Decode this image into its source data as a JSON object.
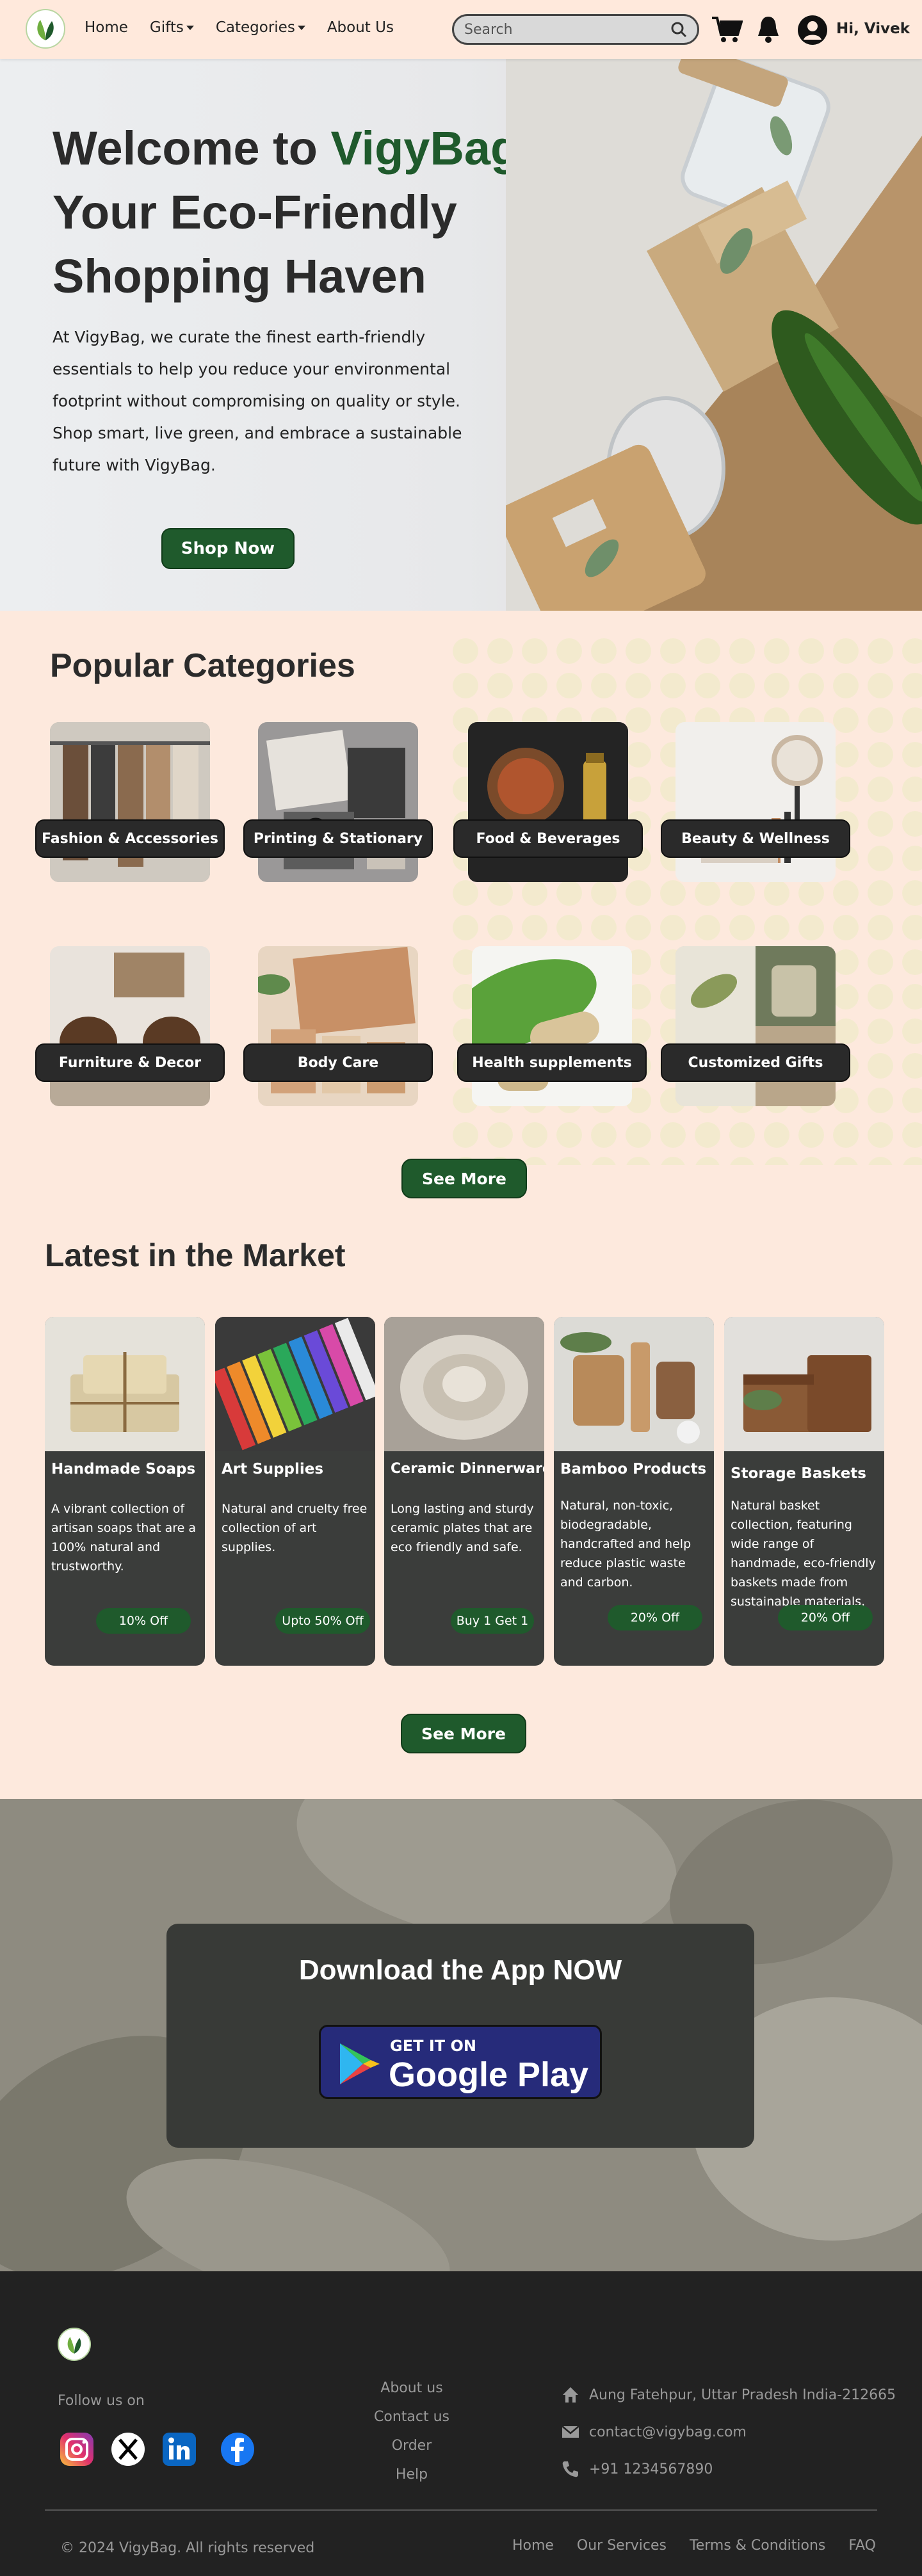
{
  "nav": {
    "links": [
      "Home",
      "Gifts",
      "Categories",
      "About Us"
    ],
    "search_placeholder": "Search",
    "user_greeting": "Hi, Vivek"
  },
  "hero": {
    "title_part1": "Welcome to ",
    "brand": "VigyBag",
    "title_part2": "!",
    "title_line2": "Your Eco-Friendly",
    "title_line3": "Shopping Haven",
    "description": "At VigyBag, we curate the finest earth-friendly essentials to help you reduce your environmental footprint without compromising on quality or style. Shop smart, live green, and embrace a sustainable future with VigyBag.",
    "cta": "Shop Now"
  },
  "categories": {
    "title": "Popular Categories",
    "items": [
      {
        "label": "Fashion & Accessories"
      },
      {
        "label": "Printing & Stationary"
      },
      {
        "label": "Food & Beverages"
      },
      {
        "label": "Beauty & Wellness"
      },
      {
        "label": "Furniture & Decor"
      },
      {
        "label": "Body Care"
      },
      {
        "label": "Health supplements"
      },
      {
        "label": "Customized Gifts"
      }
    ],
    "see_more": "See More"
  },
  "latest": {
    "title": "Latest in the Market",
    "items": [
      {
        "name": "Handmade Soaps",
        "desc": "A vibrant collection of artisan soaps that are a 100% natural and trustworthy.",
        "offer": "10% Off"
      },
      {
        "name": "Art Supplies",
        "desc": "Natural and cruelty free collection of art supplies.",
        "offer": "Upto 50% Off"
      },
      {
        "name": "Ceramic Dinnerware",
        "desc": "Long lasting and sturdy ceramic plates that are eco friendly and safe.",
        "offer": "Buy 1 Get 1"
      },
      {
        "name": "Bamboo Products",
        "desc": "Natural, non-toxic, biodegradable, handcrafted and help reduce plastic waste and carbon.",
        "offer": "20% Off"
      },
      {
        "name": "Storage Baskets",
        "desc": "Natural basket collection, featuring wide range of handmade, eco-friendly baskets made from sustainable materials.",
        "offer": "20% Off"
      }
    ],
    "see_more": "See More"
  },
  "app": {
    "title": "Download the App NOW",
    "badge_small": "GET IT ON",
    "badge_large": "Google Play"
  },
  "footer": {
    "follow": "Follow us on",
    "links": [
      "About us",
      "Contact us",
      "Order",
      "Help"
    ],
    "address": "Aung Fatehpur, Uttar Pradesh India-212665",
    "email": "contact@vigybag.com",
    "phone": "+91 1234567890",
    "copyright": "© 2024 VigyBag. All rights reserved",
    "bottom_links": [
      "Home",
      "Our Services",
      "Terms & Conditions",
      "FAQ"
    ]
  },
  "colors": {
    "brand_green": "#1f5a2c",
    "page_bg": "#fde9dd",
    "card_dark": "#3b3d3b",
    "footer_bg": "#222222"
  }
}
